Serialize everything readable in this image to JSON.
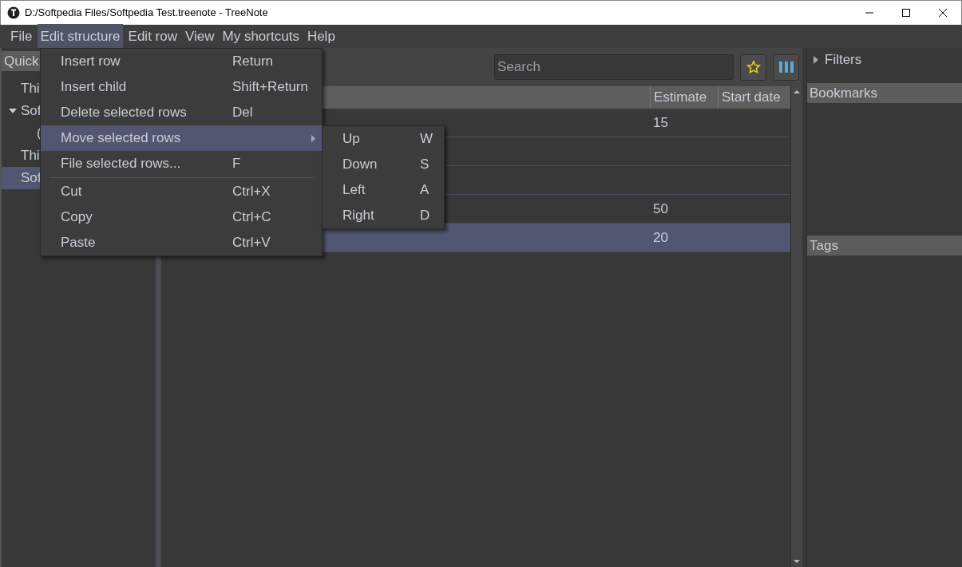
{
  "window": {
    "title": "D:/Softpedia Files/Softpedia Test.treenote - TreeNote"
  },
  "menubar": [
    {
      "label": "File",
      "selected": false
    },
    {
      "label": "Edit structure",
      "selected": true
    },
    {
      "label": "Edit row",
      "selected": false
    },
    {
      "label": "View",
      "selected": false
    },
    {
      "label": "My shortcuts",
      "selected": false
    },
    {
      "label": "Help",
      "selected": false
    }
  ],
  "quick_access": {
    "header": "Quick",
    "items": [
      {
        "label": "Thi",
        "selected": false
      },
      {
        "label": "Sof",
        "selected": false,
        "expanded": true,
        "children": [
          {
            "label": "(",
            "selected": false
          }
        ]
      },
      {
        "label": "Thi",
        "selected": false
      },
      {
        "label": "Sof",
        "selected": true
      }
    ]
  },
  "search": {
    "placeholder": "Search"
  },
  "table": {
    "columns": [
      "Estimate",
      "Start date"
    ],
    "rows": [
      {
        "estimate": "15",
        "selected": false
      },
      {
        "selected": false
      },
      {
        "selected": false
      },
      {
        "estimate": "50",
        "selected": false
      },
      {
        "estimate": "20",
        "selected": true
      }
    ]
  },
  "right_panel": {
    "filters": {
      "label": "Filters",
      "expanded": false
    },
    "bookmarks": "Bookmarks",
    "tags": "Tags"
  },
  "menu": [
    {
      "kind": "item",
      "label": "Insert row",
      "shortcut": "Return",
      "selected": false
    },
    {
      "kind": "item",
      "label": "Insert child",
      "shortcut": "Shift+Return",
      "selected": false
    },
    {
      "kind": "item",
      "label": "Delete selected rows",
      "shortcut": "Del",
      "selected": false
    },
    {
      "kind": "submenu",
      "label": "Move selected rows",
      "selected": true
    },
    {
      "kind": "item",
      "label": "File selected rows...",
      "shortcut": "F",
      "selected": false
    },
    {
      "kind": "separator"
    },
    {
      "kind": "item",
      "label": "Cut",
      "shortcut": "Ctrl+X",
      "selected": false
    },
    {
      "kind": "item",
      "label": "Copy",
      "shortcut": "Ctrl+C",
      "selected": false
    },
    {
      "kind": "item",
      "label": "Paste",
      "shortcut": "Ctrl+V",
      "selected": false
    }
  ],
  "submenu": [
    {
      "label": "Up",
      "shortcut": "W"
    },
    {
      "label": "Down",
      "shortcut": "S"
    },
    {
      "label": "Left",
      "shortcut": "A"
    },
    {
      "label": "Right",
      "shortcut": "D"
    }
  ]
}
